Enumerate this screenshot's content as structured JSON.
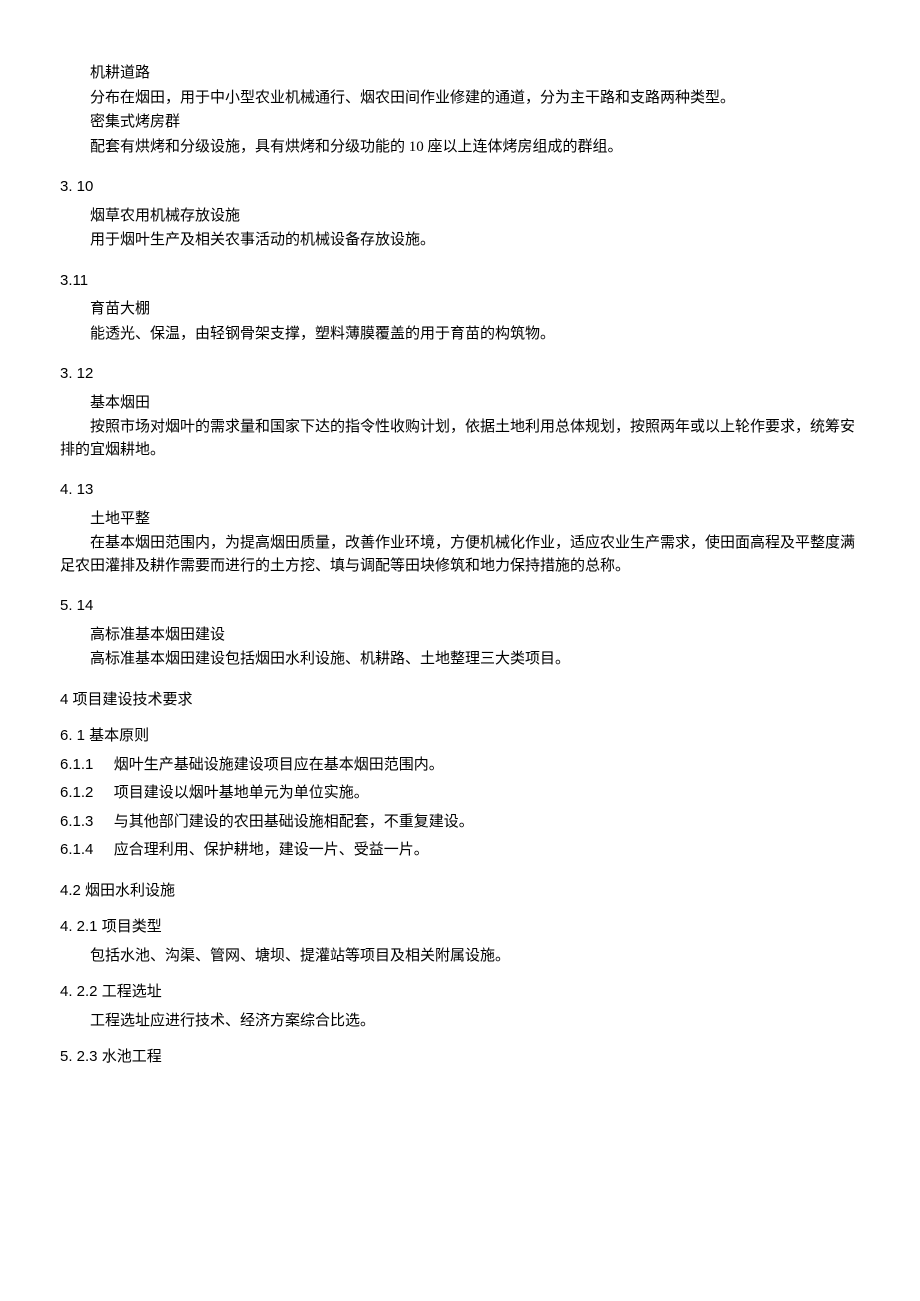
{
  "items": [
    {
      "kind": "term",
      "text": "机耕道路"
    },
    {
      "kind": "desc",
      "text": "分布在烟田，用于中小型农业机械通行、烟农田间作业修建的通道，分为主干路和支路两种类型。"
    },
    {
      "kind": "term",
      "text": "密集式烤房群"
    },
    {
      "kind": "desc",
      "text": "配套有烘烤和分级设施，具有烘烤和分级功能的 10 座以上连体烤房组成的群组。"
    },
    {
      "kind": "section-num",
      "text": "3.   10"
    },
    {
      "kind": "term",
      "text": "烟草农用机械存放设施"
    },
    {
      "kind": "desc",
      "text": "用于烟叶生产及相关农事活动的机械设备存放设施。"
    },
    {
      "kind": "section-num",
      "text": "3.11"
    },
    {
      "kind": "term",
      "text": "育苗大棚"
    },
    {
      "kind": "desc",
      "text": "能透光、保温，由轻钢骨架支撑，塑料薄膜覆盖的用于育苗的构筑物。"
    },
    {
      "kind": "section-num",
      "text": "3.   12"
    },
    {
      "kind": "term",
      "text": "基本烟田"
    },
    {
      "kind": "desc",
      "text": "按照市场对烟叶的需求量和国家下达的指令性收购计划，依据土地利用总体规划，按照两年或以上轮作要求，统筹安排的宜烟耕地。"
    },
    {
      "kind": "section-num",
      "text": "4.   13"
    },
    {
      "kind": "term",
      "text": "土地平整"
    },
    {
      "kind": "desc",
      "text": "在基本烟田范围内，为提高烟田质量，改善作业环境，方便机械化作业，适应农业生产需求，使田面高程及平整度满足农田灌排及耕作需要而进行的土方挖、填与调配等田块修筑和地力保持措施的总称。"
    },
    {
      "kind": "section-num",
      "text": "5.   14"
    },
    {
      "kind": "term",
      "text": "高标准基本烟田建设"
    },
    {
      "kind": "desc",
      "text": "高标准基本烟田建设包括烟田水利设施、机耕路、土地整理三大类项目。"
    },
    {
      "kind": "heading",
      "text": "4 项目建设技术要求"
    },
    {
      "kind": "sub-heading",
      "text": "6.   1 基本原则"
    },
    {
      "kind": "list-item",
      "num": "6.1.1",
      "text": "烟叶生产基础设施建设项目应在基本烟田范围内。"
    },
    {
      "kind": "list-item",
      "num": "6.1.2",
      "text": "项目建设以烟叶基地单元为单位实施。"
    },
    {
      "kind": "list-item",
      "num": "6.1.3",
      "text": "与其他部门建设的农田基础设施相配套，不重复建设。"
    },
    {
      "kind": "list-item",
      "num": "6.1.4",
      "text": "应合理利用、保护耕地，建设一片、受益一片。"
    },
    {
      "kind": "heading",
      "text": "4.2 烟田水利设施"
    },
    {
      "kind": "sub-heading",
      "text": "4.   2.1 项目类型"
    },
    {
      "kind": "desc",
      "text": "包括水池、沟渠、管网、塘坝、提灌站等项目及相关附属设施。"
    },
    {
      "kind": "sub-heading",
      "text": "4.   2.2 工程选址"
    },
    {
      "kind": "desc",
      "text": "工程选址应进行技术、经济方案综合比选。"
    },
    {
      "kind": "sub-heading",
      "text": "5.   2.3 水池工程"
    }
  ]
}
